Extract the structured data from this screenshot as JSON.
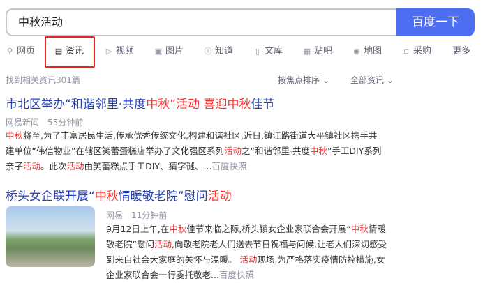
{
  "search": {
    "query": "中秋活动",
    "button": "百度一下"
  },
  "tabs": [
    {
      "label": "网页",
      "icon": "search-icon"
    },
    {
      "label": "资讯",
      "icon": "news-icon"
    },
    {
      "label": "视频",
      "icon": "video-icon"
    },
    {
      "label": "图片",
      "icon": "image-icon"
    },
    {
      "label": "知道",
      "icon": "question-icon"
    },
    {
      "label": "文库",
      "icon": "doc-icon"
    },
    {
      "label": "贴吧",
      "icon": "tieba-icon"
    },
    {
      "label": "地图",
      "icon": "map-icon"
    },
    {
      "label": "采购",
      "icon": "purchase-icon"
    },
    {
      "label": "更多",
      "icon": ""
    }
  ],
  "meta": {
    "count": "找到相关资讯301篇",
    "sort": "按焦点排序",
    "filter": "全部资讯"
  },
  "results": [
    {
      "title_parts": [
        "市北区举办“和谐邻里·共度",
        "中秋",
        "”活动 喜迎",
        "中秋",
        "佳节"
      ],
      "source": "网易新闻",
      "time": "55分钟前",
      "snippet_lines": [
        [
          "中秋",
          "将至,为了丰富居民生活,传承优秀传统文化,构建和谐社区,近日,镇江路街道大平镇社区携手共"
        ],
        [
          "建单位“伟信物业”在辖区笑蕾蛋糕店举办了文化强区系列",
          "活动",
          "之“和谐邻里·共度",
          "中秋",
          "”手工DIY系列"
        ],
        [
          "亲子",
          "活动",
          "。此次",
          "活动",
          "由笑蕾糕点手工DIY、猜字谜、...",
          "百度快照"
        ]
      ]
    },
    {
      "title_parts": [
        "桥头女企联开展“",
        "中秋",
        "情暖敬老院”慰问",
        "活动"
      ],
      "source": "网易",
      "time": "11分钟前",
      "snippet_lines": [
        [
          "9月12日上午,在",
          "中秋",
          "佳节来临之际,桥头镇女企业家联合会开展“",
          "中秋",
          "情暖"
        ],
        [
          "敬老院”慰问",
          "活动",
          ",向敬老院老人们送去节日祝福与问候,让老人们深切感受"
        ],
        [
          "到来自社会大家庭的关怀与温暖。 ",
          "活动",
          "现场,为严格落实疫情防控措施,女"
        ],
        [
          "企业家联合会一行委托敬老...",
          "百度快照"
        ]
      ]
    }
  ],
  "colors": {
    "accent": "#4e6ef2",
    "link": "#2440b3",
    "highlight": "#f73131"
  }
}
